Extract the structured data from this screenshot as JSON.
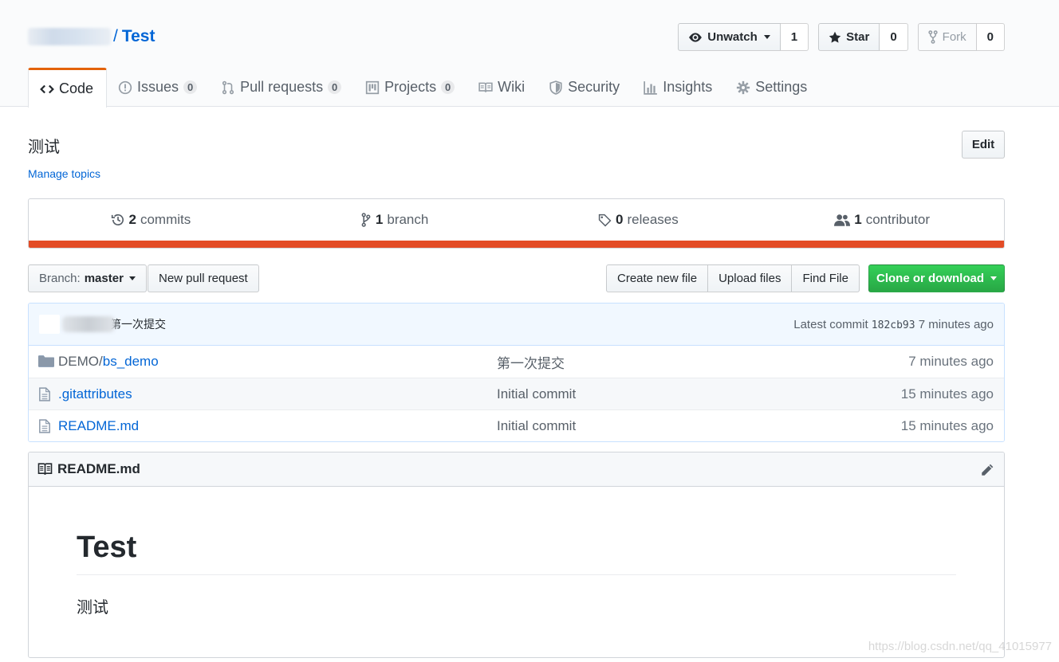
{
  "repo": {
    "slash": "/",
    "name": "Test"
  },
  "actions": {
    "watch": {
      "label": "Unwatch",
      "count": "1"
    },
    "star": {
      "label": "Star",
      "count": "0"
    },
    "fork": {
      "label": "Fork",
      "count": "0"
    }
  },
  "tabs": [
    {
      "label": "Code",
      "icon": "code-icon"
    },
    {
      "label": "Issues",
      "count": "0",
      "icon": "issue-opened-icon"
    },
    {
      "label": "Pull requests",
      "count": "0",
      "icon": "git-pull-request-icon"
    },
    {
      "label": "Projects",
      "count": "0",
      "icon": "project-icon"
    },
    {
      "label": "Wiki",
      "icon": "book-icon"
    },
    {
      "label": "Security",
      "icon": "shield-icon"
    },
    {
      "label": "Insights",
      "icon": "graph-icon"
    },
    {
      "label": "Settings",
      "icon": "gear-icon"
    }
  ],
  "about": {
    "description": "测试",
    "manage_topics": "Manage topics",
    "edit": "Edit"
  },
  "summary": {
    "commits": {
      "count": "2",
      "label": "commits"
    },
    "branches": {
      "count": "1",
      "label": "branch"
    },
    "releases": {
      "count": "0",
      "label": "releases"
    },
    "contributors": {
      "count": "1",
      "label": "contributor"
    },
    "language_color": "#e34c26"
  },
  "toolbar": {
    "branch_label": "Branch:",
    "branch_name": "master",
    "new_pr": "New pull request",
    "create_file": "Create new file",
    "upload_files": "Upload files",
    "find_file": "Find File",
    "clone": "Clone or download"
  },
  "latest_commit": {
    "message": "第一次提交",
    "prefix": "Latest commit",
    "sha": "182cb93",
    "age": "7 minutes ago"
  },
  "files": [
    {
      "type": "directory",
      "dir": "DEMO/",
      "name": "bs_demo",
      "message": "第一次提交",
      "age": "7 minutes ago"
    },
    {
      "type": "file",
      "name": ".gitattributes",
      "message": "Initial commit",
      "age": "15 minutes ago"
    },
    {
      "type": "file",
      "name": "README.md",
      "message": "Initial commit",
      "age": "15 minutes ago"
    }
  ],
  "readme": {
    "filename": "README.md",
    "heading": "Test",
    "body": "测试"
  },
  "watermark": "https://blog.csdn.net/qq_41015977"
}
